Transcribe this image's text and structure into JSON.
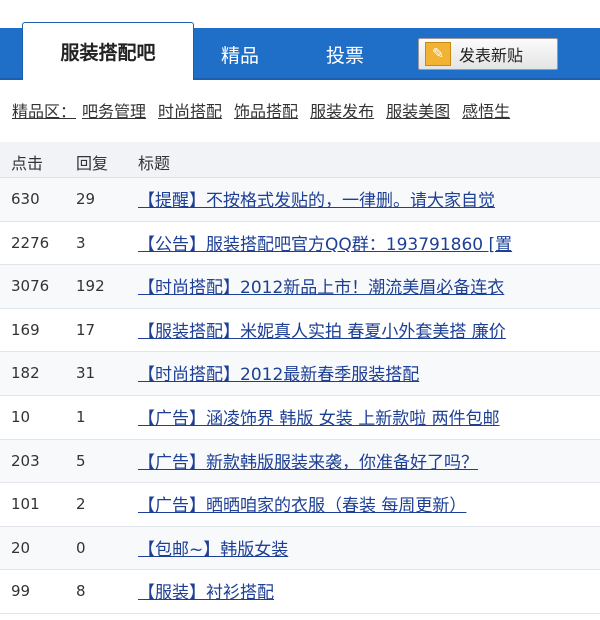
{
  "tabs": {
    "active": "服装搭配吧",
    "elite": "精品",
    "vote": "投票"
  },
  "post_button": {
    "label": "发表新贴",
    "icon": "pen-icon"
  },
  "elite_bar": {
    "title": "精品区：",
    "links": [
      "吧务管理",
      "时尚搭配",
      "饰品搭配",
      "服装发布",
      "服装美图",
      "感悟生"
    ]
  },
  "table": {
    "headers": {
      "clicks": "点击",
      "replies": "回复",
      "title": "标题"
    },
    "rows": [
      {
        "clicks": "630",
        "replies": "29",
        "tag": "【提醒】",
        "title": "不按格式发贴的，一律删。请大家自觉"
      },
      {
        "clicks": "2276",
        "replies": "3",
        "tag": "【公告】",
        "title": "服装搭配吧官方QQ群：193791860 [置"
      },
      {
        "clicks": "3076",
        "replies": "192",
        "tag": "【时尚搭配】",
        "title": "2012新品上市！潮流美眉必备连衣"
      },
      {
        "clicks": "169",
        "replies": "17",
        "tag": "【服装搭配】",
        "title": "米妮真人实拍 春夏小外套美搭 廉价"
      },
      {
        "clicks": "182",
        "replies": "31",
        "tag": "【时尚搭配】",
        "title": "2012最新春季服装搭配"
      },
      {
        "clicks": "10",
        "replies": "1",
        "tag": "【广告】",
        "title": "涵凌饰界 韩版 女装 上新款啦 两件包邮"
      },
      {
        "clicks": "203",
        "replies": "5",
        "tag": "【广告】",
        "title": "新款韩版服装来袭，你准备好了吗？"
      },
      {
        "clicks": "101",
        "replies": "2",
        "tag": "【广告】",
        "title": "晒晒咱家的衣服（春装 每周更新）"
      },
      {
        "clicks": "20",
        "replies": "0",
        "tag": "【包邮~】",
        "title": "韩版女装"
      },
      {
        "clicks": "99",
        "replies": "8",
        "tag": "【服装】",
        "title": "衬衫搭配"
      }
    ]
  },
  "colors": {
    "tab_bar": "#1f6fc8",
    "link": "#1d3f95"
  }
}
